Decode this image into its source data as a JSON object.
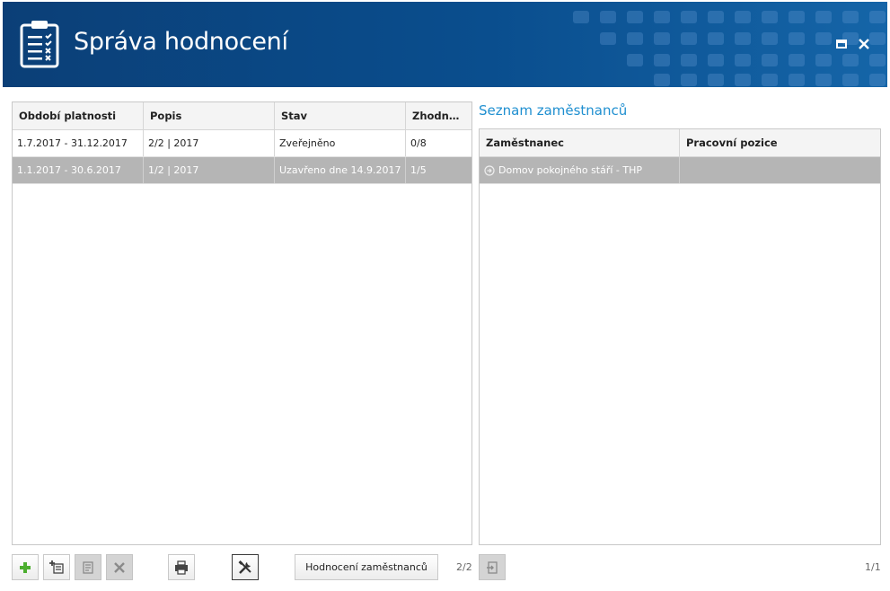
{
  "app": {
    "title": "Správa hodnocení",
    "colors": {
      "header": "#0b4a88",
      "accent": "#1f8fd0",
      "selected_row": "#b5b5b5"
    }
  },
  "window_controls": {
    "maximize_icon": "maximize-icon",
    "close_icon": "close-icon"
  },
  "periods_table": {
    "columns": [
      "Období platnosti",
      "Popis",
      "Stav",
      "Zhodnoc..."
    ],
    "rows": [
      [
        "1.7.2017 - 31.12.2017",
        "2/2 | 2017",
        "Zveřejněno",
        "0/8"
      ],
      [
        "1.1.2017 - 30.6.2017",
        "1/2 | 2017",
        "Uzavřeno dne 14.9.2017",
        "1/5"
      ]
    ],
    "selected_row_index": 1
  },
  "employees": {
    "title": "Seznam zaměstnanců",
    "columns": [
      "Zaměstnanec",
      "Pracovní pozice"
    ],
    "rows": [
      [
        "Domov pokojného stáří - THP",
        ""
      ]
    ]
  },
  "toolbar": {
    "add_icon": "plus-icon",
    "add_sub_icon": "add-list-icon",
    "edit_icon": "edit-document-icon",
    "delete_icon": "delete-x-icon",
    "print_icon": "printer-icon",
    "tools_icon": "tools-icon",
    "employee_eval_label": "Hodnocení zaměstnanců",
    "left_pager": "2/2",
    "export_icon": "export-icon",
    "right_pager": "1/1"
  }
}
